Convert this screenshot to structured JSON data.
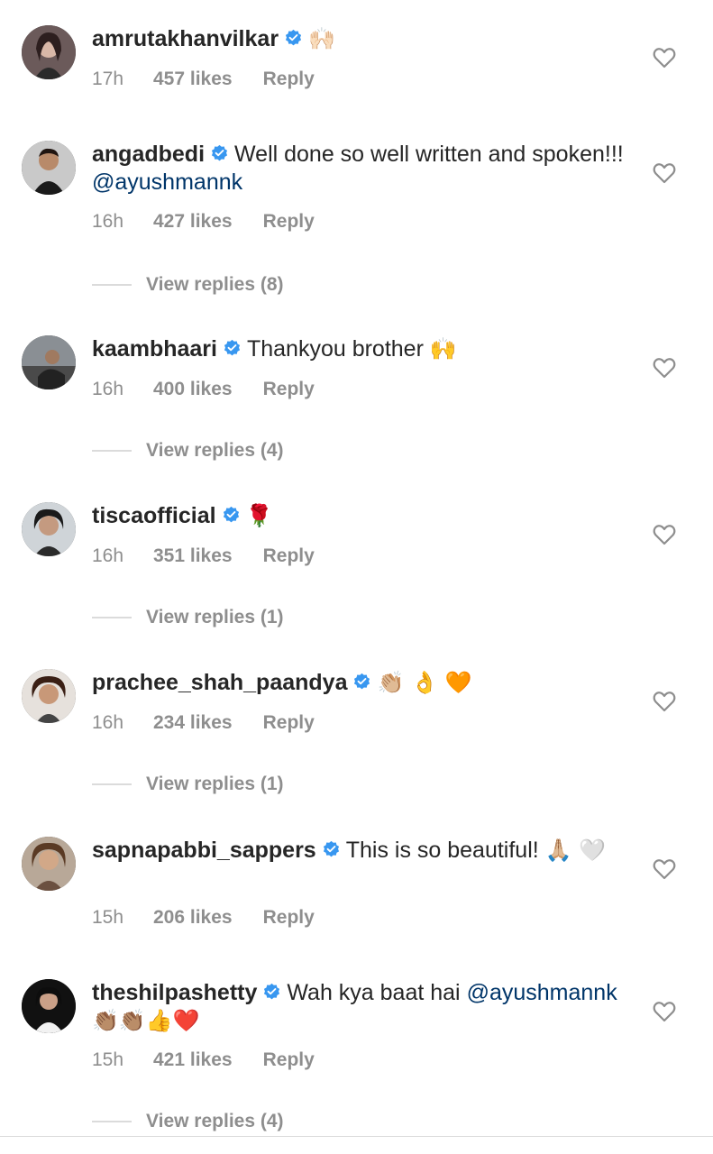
{
  "colors": {
    "text": "#262626",
    "meta": "#8e8e8e",
    "mention": "#003569",
    "verified": "#3897f0"
  },
  "comments": [
    {
      "username": "amrutakhanvilkar",
      "text": "",
      "emoji": "🙌🏻",
      "time": "17h",
      "likes": "457 likes",
      "reply": "Reply",
      "view_replies": ""
    },
    {
      "username": "angadbedi",
      "text": "Well done so well written and spoken!!! ",
      "mention": "@ayushmannk",
      "time": "16h",
      "likes": "427 likes",
      "reply": "Reply",
      "view_replies": "View replies (8)"
    },
    {
      "username": "kaambhaari",
      "text": "Thankyou brother ",
      "emoji": "🙌",
      "time": "16h",
      "likes": "400 likes",
      "reply": "Reply",
      "view_replies": "View replies (4)"
    },
    {
      "username": "tiscaofficial",
      "text": "",
      "emoji": "🌹",
      "time": "16h",
      "likes": "351 likes",
      "reply": "Reply",
      "view_replies": "View replies (1)"
    },
    {
      "username": "prachee_shah_paandya",
      "text": "",
      "emoji": "👏🏼 👌 🧡",
      "time": "16h",
      "likes": "234 likes",
      "reply": "Reply",
      "view_replies": "View replies (1)"
    },
    {
      "username": "sapnapabbi_sappers",
      "text": "This is so beautiful! ",
      "emoji": "🙏🏼 🤍",
      "time": "15h",
      "likes": "206 likes",
      "reply": "Reply",
      "view_replies": ""
    },
    {
      "username": "theshilpashetty",
      "text": "Wah kya baat hai ",
      "mention": "@ayushmannk",
      "emoji": "👏🏽👏🏽👍❤️",
      "time": "15h",
      "likes": "421 likes",
      "reply": "Reply",
      "view_replies": "View replies (4)"
    }
  ]
}
